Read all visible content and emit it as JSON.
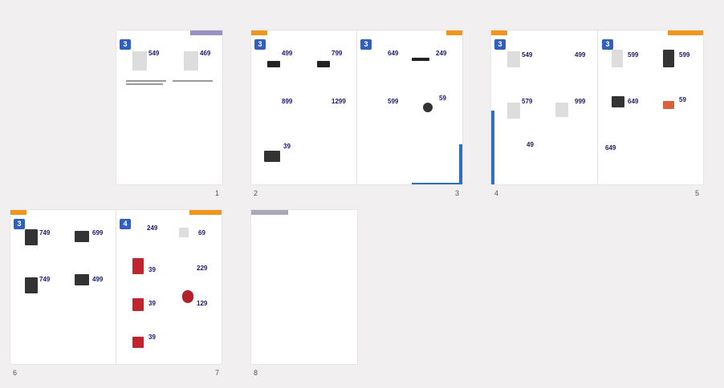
{
  "page_numbers": [
    "1",
    "2",
    "3",
    "4",
    "5",
    "6",
    "7",
    "8"
  ],
  "badges": [
    "3",
    "3",
    "3",
    "3",
    "3",
    "3",
    "4"
  ],
  "prices": {
    "p1a": "549",
    "p1b": "469",
    "p2a": "499",
    "p2b": "799",
    "p2c": "899",
    "p2d": "1299",
    "p2e": "39",
    "p3a": "649",
    "p3b": "249",
    "p3c": "599",
    "p3d": "59",
    "p4a": "549",
    "p4b": "499",
    "p4c": "579",
    "p4d": "999",
    "p4e": "49",
    "p5a": "599",
    "p5b": "599",
    "p5c": "649",
    "p5d": "59",
    "p5e": "649",
    "p6a": "749",
    "p6b": "699",
    "p6c": "749",
    "p6d": "499",
    "p7a": "249",
    "p7b": "69",
    "p7c": "39",
    "p7d": "229",
    "p7e": "39",
    "p7f": "129",
    "p7g": "39"
  },
  "colors": {
    "orange": "#f0961e",
    "purple": "#9a8fc4",
    "navy": "#2f3a8a",
    "blue": "#2f5fbf",
    "grey": "#a8a8b8"
  }
}
